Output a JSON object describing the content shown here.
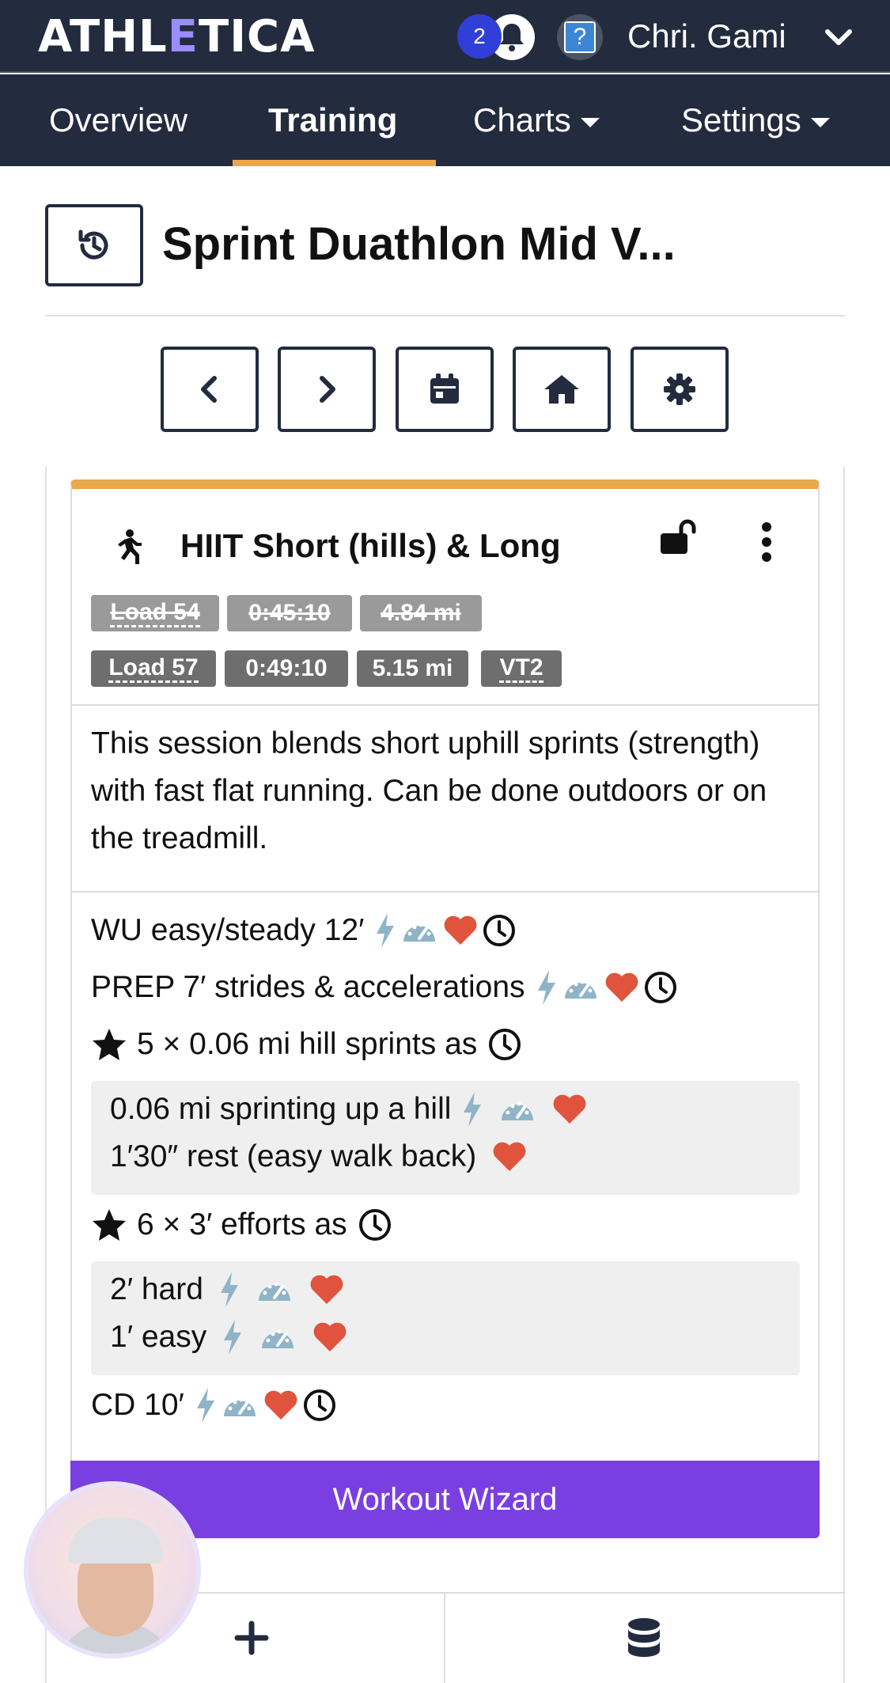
{
  "header": {
    "logo_prefix": "ATHL",
    "logo_e": "E",
    "logo_suffix": "TICA",
    "notification_count": "2",
    "help_label": "?",
    "user_name": "Chri. Gami"
  },
  "nav": {
    "tabs": [
      {
        "label": "Overview"
      },
      {
        "label": "Training",
        "active": true
      },
      {
        "label": "Charts"
      },
      {
        "label": "Settings"
      }
    ]
  },
  "page": {
    "title": "Sprint Duathlon Mid V..."
  },
  "workout": {
    "title": "HIIT Short (hills) & Long",
    "planned": {
      "load": "Load 54",
      "time": "0:45:10",
      "distance": "4.84 mi"
    },
    "actual": {
      "load": "Load 57",
      "time": "0:49:10",
      "distance": "5.15 mi",
      "zone": "VT2"
    },
    "description": "This session blends short uphill sprints (strength) with fast flat running. Can be done outdoors or on the treadmill.",
    "steps": {
      "wu": "WU easy/steady 12′",
      "prep": "PREP 7′ strides & accelerations",
      "set1": "5 × 0.06 mi hill sprints as",
      "set1_a": "0.06 mi sprinting up a hill",
      "set1_b": "1′30″ rest (easy walk back)",
      "set2": "6 × 3′ efforts as",
      "set2_a": "2′ hard",
      "set2_b": "1′ easy",
      "cd": "CD 10′"
    },
    "wizard_label": "Workout Wizard"
  },
  "colors": {
    "nav_bg": "#232b3e",
    "accent_orange": "#e9a84b",
    "wizard_purple": "#7a3fe0",
    "heart_red": "#e0533d",
    "power_blue": "#8fb3c7",
    "badge_blue": "#2f3fd8"
  }
}
